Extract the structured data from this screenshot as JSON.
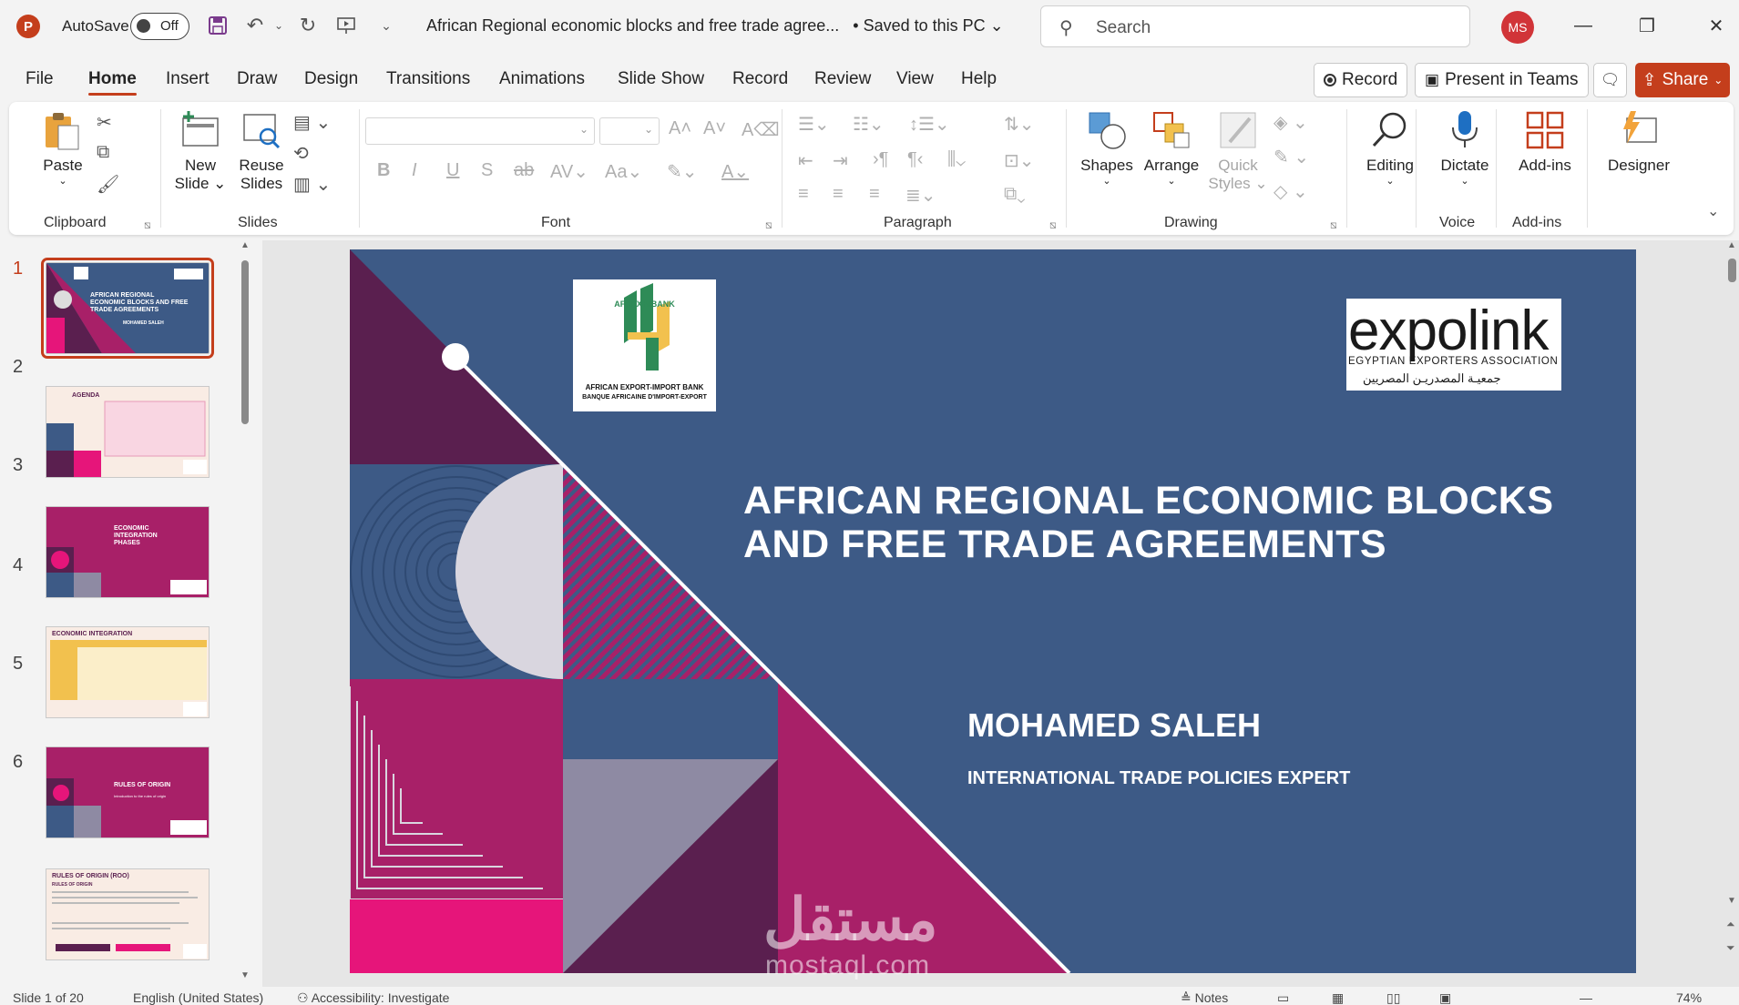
{
  "titlebar": {
    "app_icon": "P",
    "autosave_label": "AutoSave",
    "autosave_state": "Off",
    "document_title": "African Regional economic blocks and free trade agree...",
    "save_status": "• Saved to this PC",
    "search_placeholder": "Search",
    "user_initials": "MS"
  },
  "menu": {
    "tabs": [
      "File",
      "Home",
      "Insert",
      "Draw",
      "Design",
      "Transitions",
      "Animations",
      "Slide Show",
      "Record",
      "Review",
      "View",
      "Help"
    ],
    "active_tab": "Home",
    "record_label": "Record",
    "present_label": "Present in Teams",
    "share_label": "Share"
  },
  "ribbon": {
    "clipboard": {
      "paste": "Paste",
      "group": "Clipboard"
    },
    "slides": {
      "new_slide_1": "New",
      "new_slide_2": "Slide",
      "reuse_1": "Reuse",
      "reuse_2": "Slides",
      "group": "Slides"
    },
    "font": {
      "group": "Font"
    },
    "paragraph": {
      "group": "Paragraph"
    },
    "drawing": {
      "shapes": "Shapes",
      "arrange": "Arrange",
      "quick_1": "Quick",
      "quick_2": "Styles",
      "group": "Drawing"
    },
    "editing": {
      "label": "Editing"
    },
    "voice": {
      "dictate": "Dictate",
      "group": "Voice"
    },
    "addins": {
      "label": "Add-ins",
      "group": "Add-ins"
    },
    "designer": {
      "label": "Designer"
    }
  },
  "thumbnails": [
    {
      "num": "1",
      "title": "AFRICAN REGIONAL ECONOMIC BLOCKS AND FREE TRADE AGREEMENTS",
      "sub": "MOHAMED SALEH"
    },
    {
      "num": "2",
      "title": "AGENDA"
    },
    {
      "num": "3",
      "title": "ECONOMIC INTEGRATION PHASES"
    },
    {
      "num": "4",
      "title": "ECONOMIC INTEGRATION"
    },
    {
      "num": "5",
      "title": "RULES OF ORIGIN",
      "sub": "Introduction to the rules of origin"
    },
    {
      "num": "6",
      "title": "RULES OF ORIGIN (ROO)",
      "sub": "RULES OF ORIGIN"
    }
  ],
  "slide": {
    "title_line1": "AFRICAN REGIONAL ECONOMIC BLOCKS",
    "title_line2": "AND FREE TRADE AGREEMENTS",
    "presenter": "MOHAMED SALEH",
    "role": "INTERNATIONAL TRADE POLICIES EXPERT",
    "afrex_brand": "AFREXIMBANK",
    "afrex_caption1": "AFRICAN EXPORT-IMPORT BANK",
    "afrex_caption2": "BANQUE AFRICAINE D'IMPORT-EXPORT",
    "expo_word": "expolink",
    "expo_sub": "EGYPTIAN EXPORTERS ASSOCIATION",
    "expo_ar": "جمعيـة المصدريـن المصريين"
  },
  "watermark": {
    "ar": "مستقل",
    "en": "mostaql.com"
  },
  "status": {
    "slide_counter": "Slide 1 of 20",
    "language": "English (United States)",
    "accessibility": "Accessibility: Investigate",
    "notes": "Notes",
    "zoom": "74%"
  },
  "colors": {
    "accent": "#c43e1c",
    "slide_blue": "#3d5a86",
    "magenta": "#a82068",
    "hot_pink": "#e6157a",
    "plum": "#5a1f4f",
    "grey_purple": "#8e8aa3"
  }
}
